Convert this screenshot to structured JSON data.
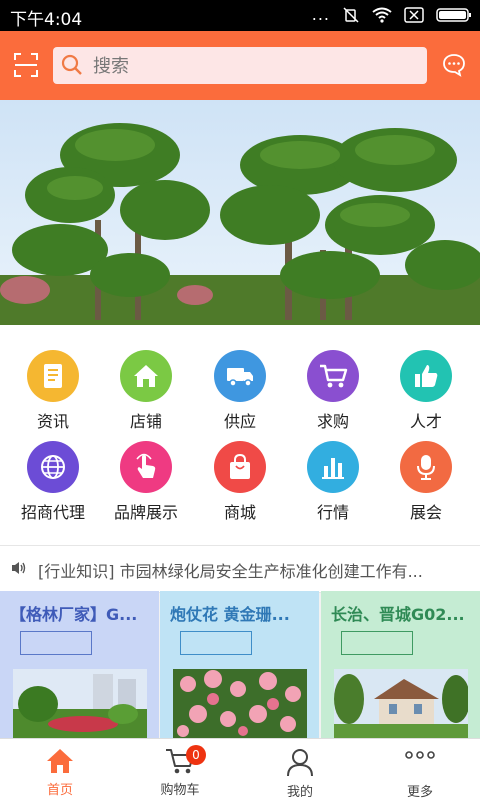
{
  "status_bar": {
    "time": "下午4:04",
    "dots": "..."
  },
  "header": {
    "search_placeholder": "搜索"
  },
  "grid": {
    "items": [
      {
        "label": "资讯",
        "color": "#f5b731"
      },
      {
        "label": "店铺",
        "color": "#7bc944"
      },
      {
        "label": "供应",
        "color": "#3f97e0"
      },
      {
        "label": "求购",
        "color": "#8a4fd0"
      },
      {
        "label": "人才",
        "color": "#22c3b2"
      },
      {
        "label": "招商代理",
        "color": "#6c4cd6"
      },
      {
        "label": "品牌展示",
        "color": "#ef3a82"
      },
      {
        "label": "商城",
        "color": "#f04a47"
      },
      {
        "label": "行情",
        "color": "#32aee0"
      },
      {
        "label": "展会",
        "color": "#f26a42"
      }
    ]
  },
  "news": {
    "text": "[行业知识] 市园林绿化局安全生产标准化创建工作有..."
  },
  "cards": [
    {
      "title": "【格林厂家】G...",
      "bg": "#c9d6f6",
      "title_color": "#3f5bb8"
    },
    {
      "title": "炮仗花 黄金珊...",
      "bg": "#bfe3f5",
      "title_color": "#2f78b6"
    },
    {
      "title": "长治、晋城G02...",
      "bg": "#c5ecd3",
      "title_color": "#2f8a55"
    }
  ],
  "tabbar": {
    "tabs": [
      {
        "label": "首页"
      },
      {
        "label": "购物车",
        "badge": "0"
      },
      {
        "label": "我的"
      },
      {
        "label": "更多"
      }
    ],
    "accent": "#fb6c3c"
  }
}
